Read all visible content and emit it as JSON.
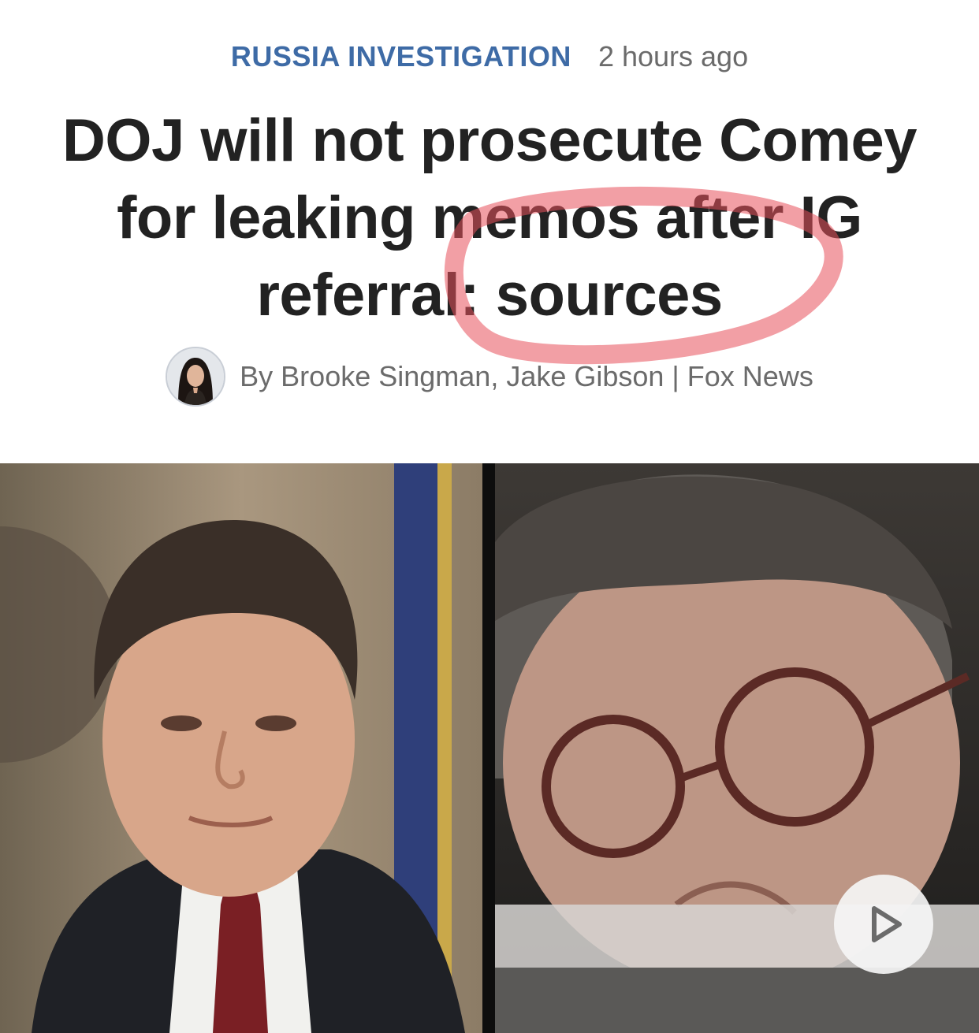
{
  "article": {
    "category": "RUSSIA INVESTIGATION",
    "timestamp": "2 hours ago",
    "headline": "DOJ will not prosecute Comey for leaking memos after IG referral: sources",
    "byline": "By Brooke Singman, Jake Gibson | Fox News"
  },
  "media": {
    "play_icon": "play-icon"
  },
  "colors": {
    "category": "#3e6ba6",
    "headline": "#222222",
    "meta_text": "#6b6b6b",
    "annotation_circle": "#e8505b"
  }
}
